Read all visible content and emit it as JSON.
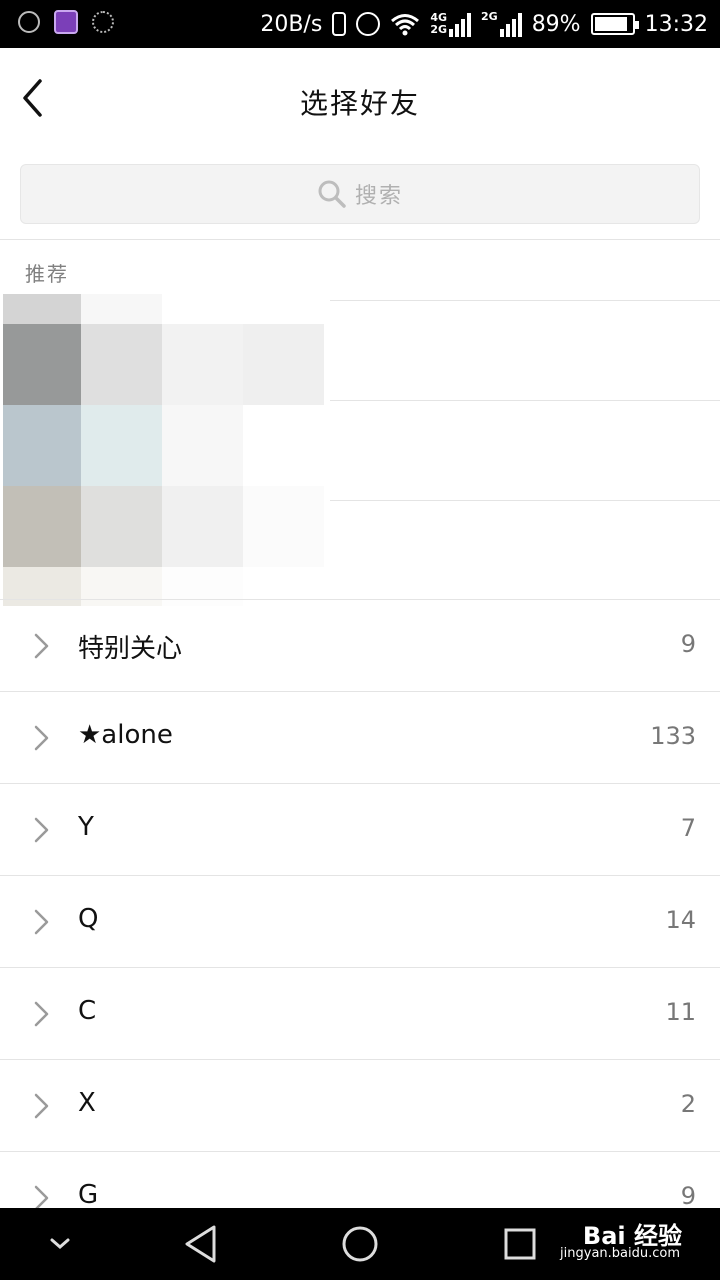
{
  "status_bar": {
    "net_speed": "20B/s",
    "sig1_top": "4G",
    "sig1_bottom": "2G",
    "sig2_top": "2G",
    "battery_pct_label": "89%",
    "battery_level": 0.89,
    "time": "13:32",
    "app_icon_color": "#7b3fb8"
  },
  "header": {
    "title": "选择好友",
    "back_icon": "chevron-left-icon"
  },
  "search": {
    "placeholder": "搜索",
    "icon": "search-icon"
  },
  "section": {
    "recommended_label": "推荐"
  },
  "groups": [
    {
      "name": "特别关心",
      "count": "9"
    },
    {
      "name": "★alone",
      "count": "133"
    },
    {
      "name": "Y",
      "count": "7"
    },
    {
      "name": "Q",
      "count": "14"
    },
    {
      "name": "C",
      "count": "11"
    },
    {
      "name": "X",
      "count": "2"
    },
    {
      "name": "G",
      "count": "9"
    }
  ],
  "navbar": {
    "watermark": "Bai 经验",
    "watermark_sub": "jingyan.baidu.com"
  }
}
